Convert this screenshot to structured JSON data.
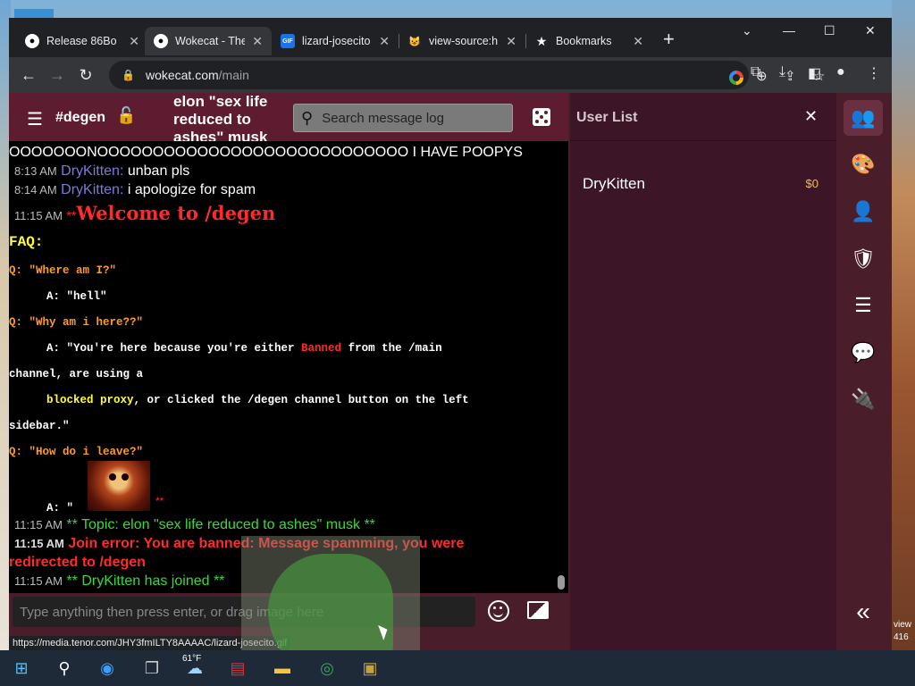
{
  "browser": {
    "tabs": [
      {
        "label": "Release 86Box",
        "icon": "github-icon",
        "active": false
      },
      {
        "label": "Wokecat - The",
        "icon": "github-icon",
        "active": true
      },
      {
        "label": "lizard-josecito",
        "icon": "gif-icon",
        "active": false
      },
      {
        "label": "view-source:h",
        "icon": "cat-icon",
        "active": false
      },
      {
        "label": "Bookmarks",
        "icon": "star-icon",
        "active": false
      }
    ],
    "url_host": "wokecat.com",
    "url_path": "/main",
    "status_url": "https://media.tenor.com/JHY3fmILTY8AAAAC/lizard-josecito.gif"
  },
  "channel": {
    "name": "#degen",
    "topic": "elon \"sex life reduced to ashes\" musk",
    "search_placeholder": "Search message log"
  },
  "chat": {
    "overflow_line": "OOOOOOONOOOOOOOOOOOOOOOOOOOOOOOOOOOO I HAVE POOPYS",
    "msg1": {
      "time": "8:13 AM",
      "nick": "DryKitten:",
      "text": "unban pls"
    },
    "msg2": {
      "time": "8:14 AM",
      "nick": "DryKitten:",
      "text": "i apologize for spam"
    },
    "welcome": {
      "time": "11:15 AM",
      "stars": "**",
      "text": "Welcome to /degen"
    },
    "faq_title": "FAQ:",
    "q1": "Q: \"Where am I?\"",
    "a1": "A: \"hell\"",
    "q2": "Q: \"Why am i here??\"",
    "a2_pre": "A: \"You're here because you're either ",
    "a2_banned": "Banned",
    "a2_post": " from the /main",
    "a2_line2": "channel, are using a",
    "a2_proxy": "blocked proxy",
    "a2_line3_post": ", or clicked the /degen channel button on the left",
    "a2_line4": "sidebar.\"",
    "q3": "Q: \"How do i leave?\"",
    "a3_pre": "A: \"",
    "a3_stars": "**",
    "topic_msg": {
      "time": "11:15 AM",
      "text": "** Topic: elon \"sex life reduced to ashes\" musk **"
    },
    "error_msg": {
      "time": "11:15 AM",
      "text": "Join error: You are banned: Message spamming, you were",
      "text2": "redirected to /degen"
    },
    "join_msg": {
      "time": "11:15 AM",
      "text": "** DryKitten has joined **"
    }
  },
  "input": {
    "placeholder": "Type anything then press enter, or drag image here"
  },
  "userlist": {
    "title": "User List",
    "users": [
      {
        "name": "DryKitten",
        "balance": "$0"
      }
    ]
  },
  "rail": {
    "buttons": [
      "users-icon",
      "palette-icon",
      "profile-icon",
      "shield-icon",
      "sliders-icon",
      "chat-bubbles-icon",
      "plug-icon"
    ],
    "collapse": "«"
  },
  "taskbar": {
    "weather": "61°F"
  },
  "desktop": {
    "side_text1": "view",
    "side_text2": "416"
  }
}
